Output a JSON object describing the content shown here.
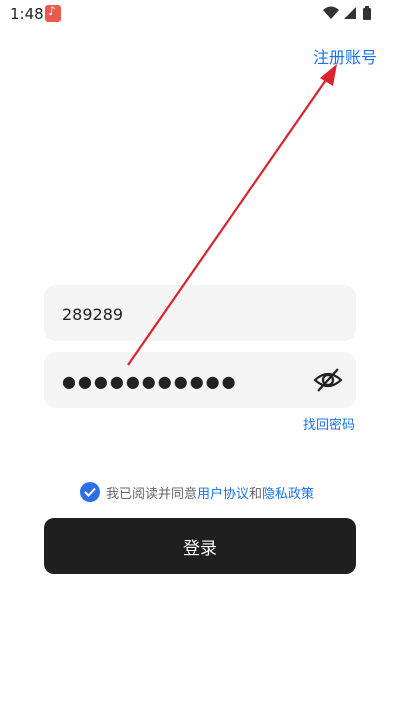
{
  "status_bar": {
    "time": "1:48",
    "icons": [
      "music-app-notification-icon",
      "wifi-icon",
      "cell-signal-icon",
      "battery-icon"
    ]
  },
  "header": {
    "register_label": "注册账号"
  },
  "form": {
    "username_value": "289289",
    "password_value": "●●●●●●●●●●●",
    "password_toggle_icon": "eye-off-icon",
    "forgot_label": "找回密码"
  },
  "agreement": {
    "checked": true,
    "prefix": "我已阅读并同意",
    "user_agreement": "用户协议",
    "and": "和",
    "privacy_policy": "隐私政策"
  },
  "login_label": "登录",
  "colors": {
    "link": "#1a73e8",
    "button_bg": "#1f1f1f",
    "field_bg": "#f4f4f4",
    "annotation_arrow": "#d9232d",
    "checkbox": "#2f6ee6"
  }
}
